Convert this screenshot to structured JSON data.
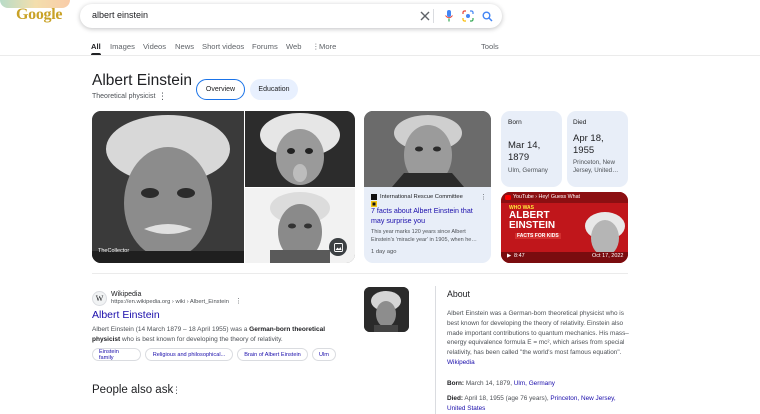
{
  "logo": {
    "text": "Google"
  },
  "search": {
    "query": "albert einstein"
  },
  "tabs": [
    {
      "label": "All",
      "active": true
    },
    {
      "label": "Images"
    },
    {
      "label": "Videos"
    },
    {
      "label": "News"
    },
    {
      "label": "Short videos"
    },
    {
      "label": "Forums"
    },
    {
      "label": "Web"
    },
    {
      "label": "More"
    }
  ],
  "tools_label": "Tools",
  "entity": {
    "title": "Albert Einstein",
    "subtitle": "Theoretical physicist",
    "chips": [
      "Overview",
      "Education"
    ]
  },
  "images": {
    "caption": "TheCollector"
  },
  "article_card": {
    "source": "International Rescue Committee",
    "title": "7 facts about Albert Einstein that may surprise you",
    "snippet": "This year marks 120 years since Albert Einstein's 'miracle year' in 1905, when he…",
    "age": "1 day ago"
  },
  "born": {
    "label": "Born",
    "date": "Mar 14, 1879",
    "place": "Ulm, Germany"
  },
  "died": {
    "label": "Died",
    "date": "Apr 18, 1955",
    "place": "Princeton, New Jersey, United…"
  },
  "video": {
    "source": "YouTube › Hey! Guess What",
    "thumb_title": "ALBERT EINSTEIN",
    "thumb_sub": "FACTS FOR KIDS",
    "thumb_top": "WHO WAS",
    "duration": "8:47",
    "date": "Oct 17, 2022"
  },
  "result": {
    "site_name": "Wikipedia",
    "url": "https://en.wikipedia.org › wiki › Albert_Einstein",
    "title": "Albert Einstein",
    "snippet_a": "Albert Einstein (14 March 1879 – 18 April 1955) was a ",
    "snippet_b": "German-born theoretical physicist",
    "snippet_c": " who is best known for developing the theory of relativity.",
    "pills": [
      "Einstein family",
      "Religious and philosophical...",
      "Brain of Albert Einstein",
      "Ulm"
    ]
  },
  "paa": {
    "title": "People also ask"
  },
  "about": {
    "title": "About",
    "text": "Albert Einstein was a German-born theoretical physicist who is best known for developing the theory of relativity. Einstein also made important contributions to quantum mechanics. His mass–energy equivalence formula E = mc², which arises from special relativity, has been called \"the world's most famous equation\".",
    "source_link": "Wikipedia",
    "born_label": "Born:",
    "born_value": "March 14, 1879,",
    "born_link": "Ulm, Germany",
    "died_label": "Died:",
    "died_value": "April 18, 1955 (age 76 years),",
    "died_link1": "Princeton,",
    "died_link2": "New Jersey,",
    "died_link3": "United States"
  },
  "colors": {
    "link": "#1a0dab",
    "accent": "#1a73e8",
    "card_bg": "#e8eef8"
  }
}
